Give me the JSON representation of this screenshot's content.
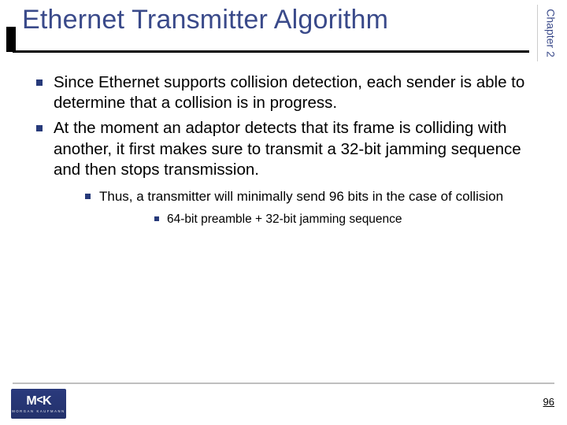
{
  "chapter_label": "Chapter 2",
  "title": "Ethernet Transmitter Algorithm",
  "bullets": {
    "b1": "Since Ethernet supports collision detection, each sender is able to determine that a collision is in progress.",
    "b2": "At the moment an adaptor detects that its frame is colliding with another, it first makes sure to transmit a 32-bit jamming sequence and then stops transmission.",
    "b2_1": "Thus, a transmitter will minimally send 96 bits in the case of collision",
    "b2_1_1": "64-bit preamble + 32-bit jamming sequence"
  },
  "logo": {
    "mark": "M<K",
    "subtext": "MORGAN KAUFMANN"
  },
  "page_number": "96"
}
